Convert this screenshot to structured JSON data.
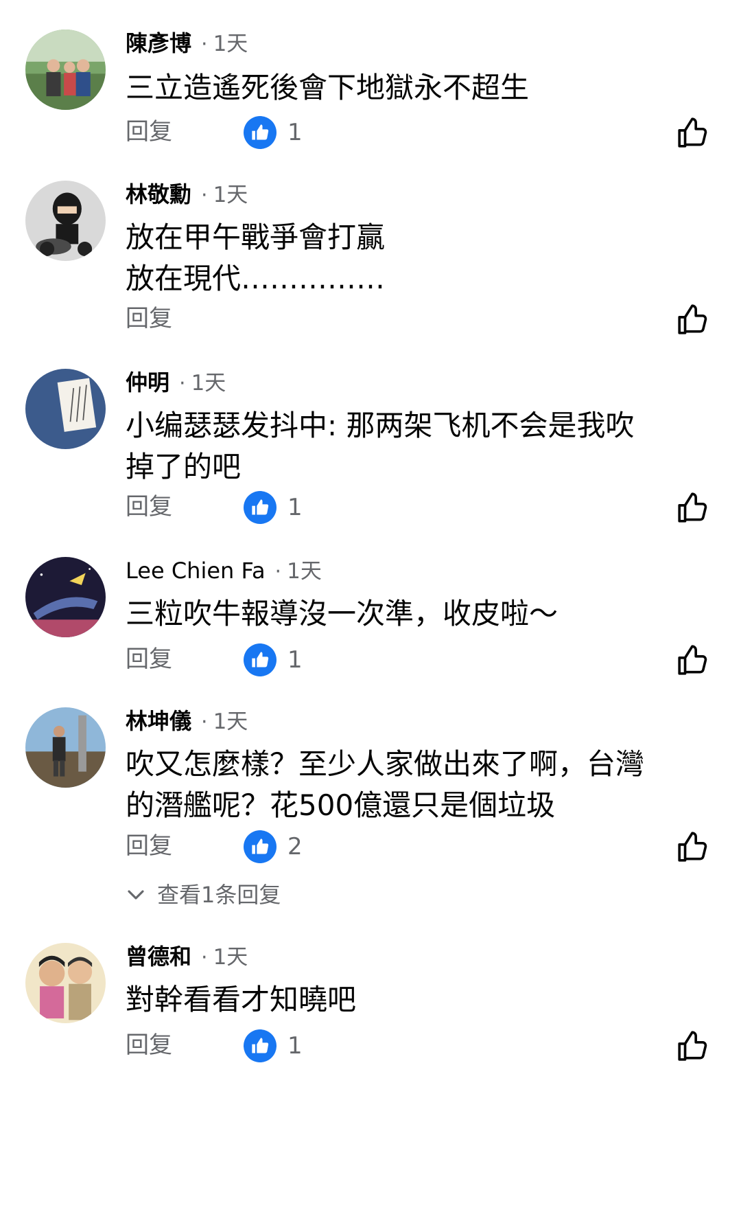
{
  "comments": [
    {
      "author": "陳彥博",
      "time": "1天",
      "lines": [
        "三立造遙死後會下地獄永不超生"
      ],
      "reply_label": "回复",
      "reaction_count": "1"
    },
    {
      "author": "林敬勳",
      "time": "1天",
      "lines": [
        "放在甲午戰爭會打贏",
        "放在現代……………"
      ],
      "reply_label": "回复",
      "reaction_count": null
    },
    {
      "author": "仲明",
      "time": "1天",
      "lines": [
        "小编瑟瑟发抖中: 那两架飞机不会是我吹",
        "掉了的吧"
      ],
      "reply_label": "回复",
      "reaction_count": "1"
    },
    {
      "author": "Lee Chien Fa",
      "time": "1天",
      "lines": [
        "三粒吹牛報導沒一次準，收皮啦～"
      ],
      "reply_label": "回复",
      "reaction_count": "1"
    },
    {
      "author": "林坤儀",
      "time": "1天",
      "lines": [
        "吹又怎麼樣？至少人家做出來了啊，台灣",
        "的潛艦呢？花500億還只是個垃圾"
      ],
      "reply_label": "回复",
      "reaction_count": "2",
      "view_replies": "查看1条回复"
    },
    {
      "author": "曾德和",
      "time": "1天",
      "lines": [
        "對幹看看才知曉吧"
      ],
      "reply_label": "回复",
      "reaction_count": "1"
    }
  ],
  "meta_separator": "·",
  "icons": {
    "reaction": "like-reaction-icon",
    "like_button": "thumbs-up-outline-icon",
    "expand": "chevron-down-icon"
  },
  "colors": {
    "reaction_blue": "#1877f2",
    "secondary_text": "#65676b"
  }
}
